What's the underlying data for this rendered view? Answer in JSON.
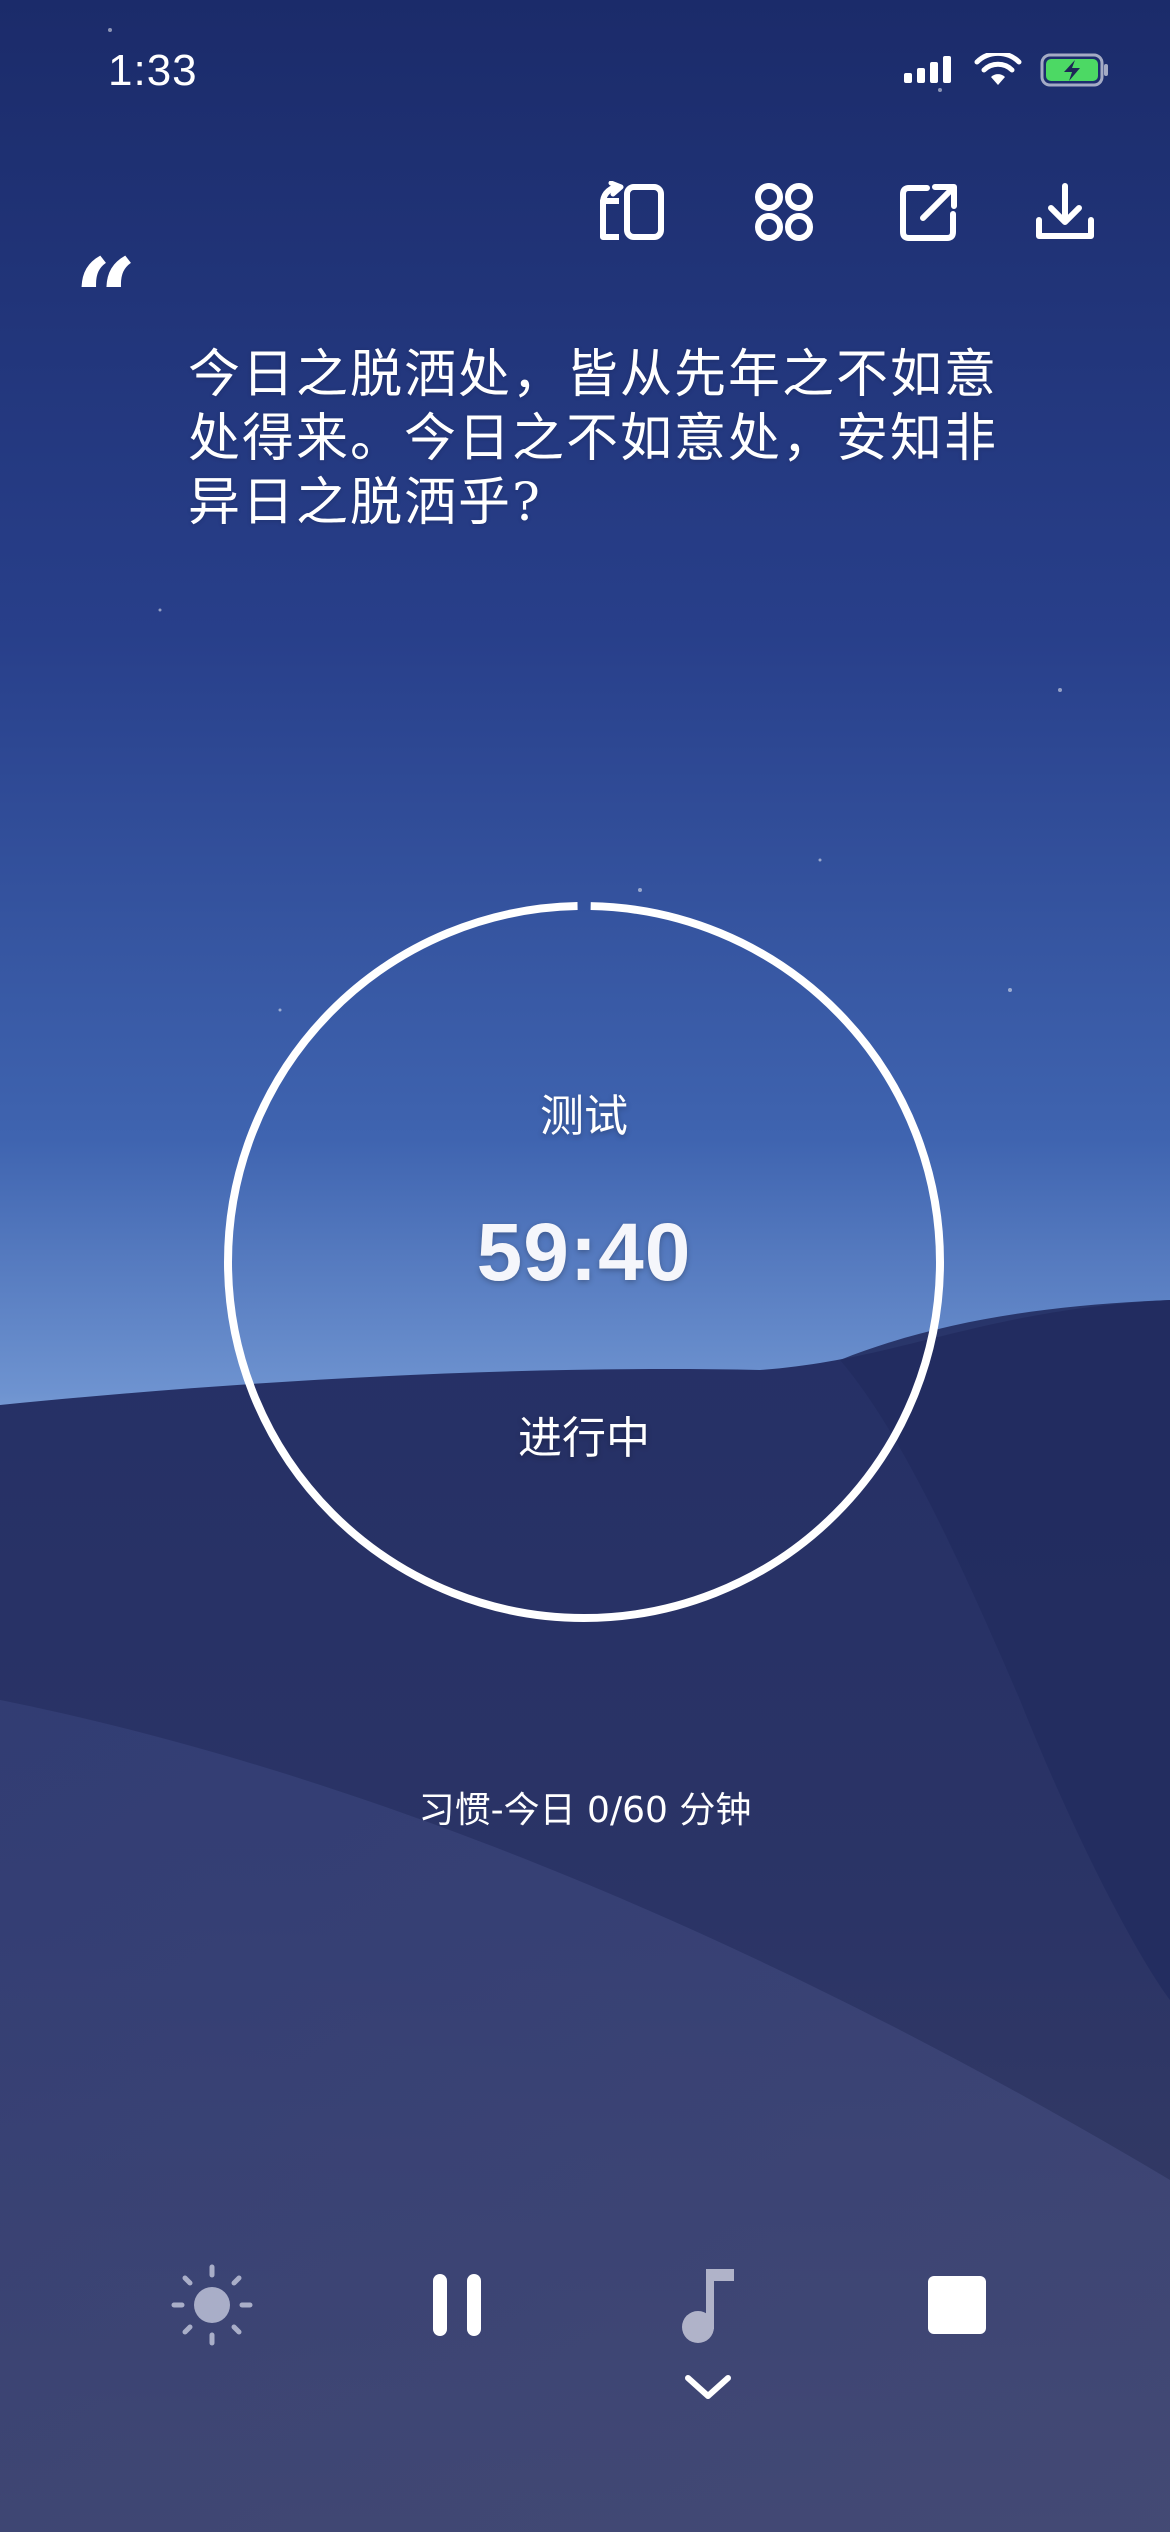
{
  "status_bar": {
    "time": "1:33",
    "icons": [
      "cellular-signal-icon",
      "wifi-icon",
      "battery-charging-icon"
    ]
  },
  "toolbar": {
    "icons": [
      "rotate-screen-icon",
      "widgets-icon",
      "share-icon",
      "download-icon"
    ]
  },
  "quote": {
    "text": "今日之脱洒处，皆从先年之不如意处得来。今日之不如意处，安知非异日之脱洒乎?"
  },
  "timer": {
    "task_name": "测试",
    "time_remaining": "59:40",
    "status": "进行中",
    "progress_fraction": 0.994
  },
  "habit_progress": {
    "text": "习惯-今日 0/60 分钟"
  },
  "controls": {
    "icons": [
      "brightness-icon",
      "pause-icon",
      "music-icon",
      "stop-icon",
      "chevron-down-icon"
    ]
  },
  "colors": {
    "accent": "#ffffff",
    "battery_green": "#4cd964"
  }
}
